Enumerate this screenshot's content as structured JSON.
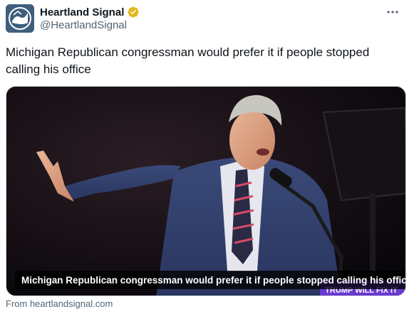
{
  "author": {
    "display_name": "Heartland Signal",
    "handle": "@HeartlandSignal",
    "verified": true,
    "avatar_icon": "heartland-signal-logo"
  },
  "tweet": {
    "text": "Michigan Republican congressman would prefer it if people stopped calling his office"
  },
  "media": {
    "caption": "Michigan Republican congressman would prefer it if people stopped calling his office",
    "sign_text": "TRUMP WILL FIX IT"
  },
  "card_source": "From heartlandsignal.com",
  "colors": {
    "verified_badge": "#e2b719",
    "secondary_text": "#536471",
    "primary_text": "#0f1419"
  }
}
